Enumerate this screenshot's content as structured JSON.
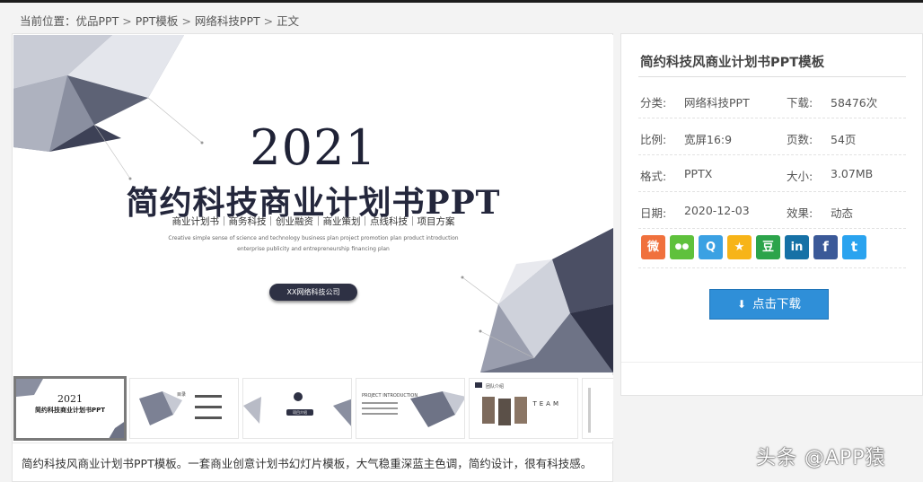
{
  "breadcrumb": {
    "prefix": "当前位置：",
    "items": [
      "优品PPT",
      "PPT模板",
      "网络科技PPT",
      "正文"
    ],
    "separator": ">"
  },
  "preview": {
    "year": "2021",
    "title": "简约科技商业计划书PPT",
    "tags": "商业计划书｜商务科技｜创业融资｜商业策划｜点线科技｜项目方案",
    "english_line1": "Creative simple sense of science and technology business plan project promotion plan product introduction",
    "english_line2": "enterprise publicity and entrepreneurship financing plan",
    "company": "XX网络科技公司"
  },
  "thumbnails": [
    {
      "year": "2021",
      "title": "简约科技商业计划书PPT"
    },
    {
      "label": "目录"
    },
    {
      "label": "项目介绍"
    },
    {
      "label": "PROJECT INTRODUCTION"
    },
    {
      "label": "团队介绍",
      "team": "TEAM"
    },
    {
      "label": ""
    }
  ],
  "description": "简约科技风商业计划书PPT模板。一套商业创意计划书幻灯片模板，大气稳重深蓝主色调，简约设计，很有科技感。",
  "info": {
    "title": "简约科技风商业计划书PPT模板",
    "category_label": "分类:",
    "category_value": "网络科技PPT",
    "downloads_label": "下载:",
    "downloads_value": "58476次",
    "ratio_label": "比例:",
    "ratio_value": "宽屏16:9",
    "pages_label": "页数:",
    "pages_value": "54页",
    "format_label": "格式:",
    "format_value": "PPTX",
    "size_label": "大小:",
    "size_value": "3.07MB",
    "date_label": "日期:",
    "date_value": "2020-12-03",
    "effect_label": "效果:",
    "effect_value": "动态"
  },
  "share_icons": [
    {
      "name": "weibo-icon",
      "glyph": "微",
      "color": "#f0713d"
    },
    {
      "name": "wechat-icon",
      "glyph": "●●",
      "color": "#5fc13c"
    },
    {
      "name": "qq-icon",
      "glyph": "Q",
      "color": "#3ba1e3"
    },
    {
      "name": "qzone-icon",
      "glyph": "★",
      "color": "#f7b418"
    },
    {
      "name": "douban-icon",
      "glyph": "豆",
      "color": "#2ca44b"
    },
    {
      "name": "linkedin-icon",
      "glyph": "in",
      "color": "#1671a6"
    },
    {
      "name": "facebook-icon",
      "glyph": "f",
      "color": "#3b5998"
    },
    {
      "name": "twitter-icon",
      "glyph": "t",
      "color": "#2aa3ef"
    }
  ],
  "download_button": "点击下载",
  "watermark": "头条 @APP猿"
}
